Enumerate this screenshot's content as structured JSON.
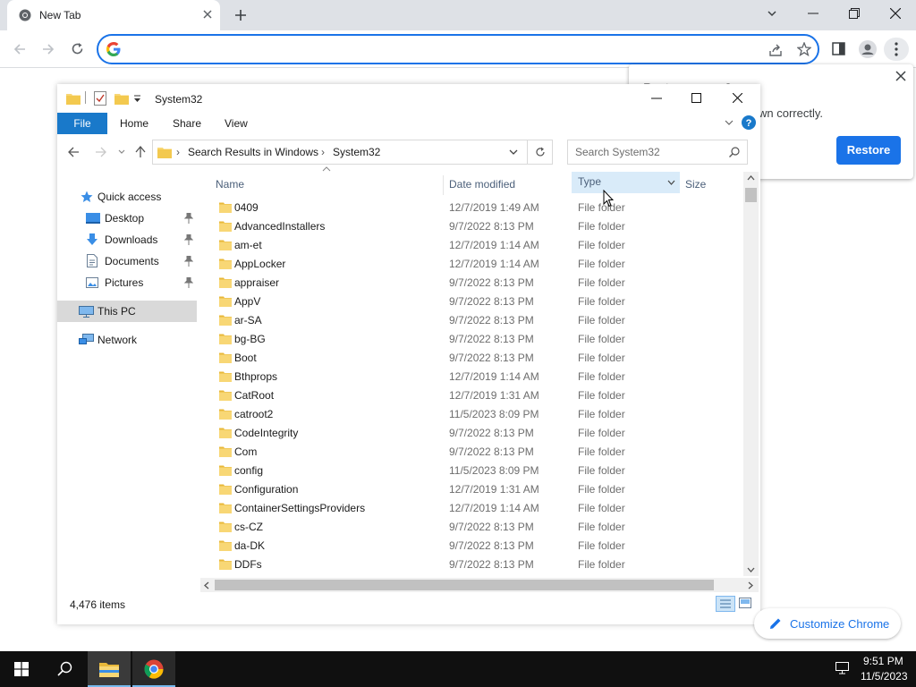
{
  "browser": {
    "tab_title": "New Tab",
    "new_tab_icon": "plus-icon",
    "customize_label": "Customize Chrome"
  },
  "restore_bubble": {
    "title_partial": "Restore pages?",
    "message_partial": "wn correctly.",
    "restore_label": "Restore"
  },
  "explorer": {
    "title": "System32",
    "ribbon_tabs": [
      "File",
      "Home",
      "Share",
      "View"
    ],
    "breadcrumb": [
      "Search Results in Windows",
      "System32"
    ],
    "search_placeholder": "Search System32",
    "nav": {
      "quick_access": "Quick access",
      "desktop": "Desktop",
      "downloads": "Downloads",
      "documents": "Documents",
      "pictures": "Pictures",
      "this_pc": "This PC",
      "network": "Network"
    },
    "columns": {
      "name": "Name",
      "date": "Date modified",
      "type": "Type",
      "size": "Size"
    },
    "rows": [
      {
        "name": "0409",
        "date": "12/7/2019 1:49 AM",
        "type": "File folder"
      },
      {
        "name": "AdvancedInstallers",
        "date": "9/7/2022 8:13 PM",
        "type": "File folder"
      },
      {
        "name": "am-et",
        "date": "12/7/2019 1:14 AM",
        "type": "File folder"
      },
      {
        "name": "AppLocker",
        "date": "12/7/2019 1:14 AM",
        "type": "File folder"
      },
      {
        "name": "appraiser",
        "date": "9/7/2022 8:13 PM",
        "type": "File folder"
      },
      {
        "name": "AppV",
        "date": "9/7/2022 8:13 PM",
        "type": "File folder"
      },
      {
        "name": "ar-SA",
        "date": "9/7/2022 8:13 PM",
        "type": "File folder"
      },
      {
        "name": "bg-BG",
        "date": "9/7/2022 8:13 PM",
        "type": "File folder"
      },
      {
        "name": "Boot",
        "date": "9/7/2022 8:13 PM",
        "type": "File folder"
      },
      {
        "name": "Bthprops",
        "date": "12/7/2019 1:14 AM",
        "type": "File folder"
      },
      {
        "name": "CatRoot",
        "date": "12/7/2019 1:31 AM",
        "type": "File folder"
      },
      {
        "name": "catroot2",
        "date": "11/5/2023 8:09 PM",
        "type": "File folder"
      },
      {
        "name": "CodeIntegrity",
        "date": "9/7/2022 8:13 PM",
        "type": "File folder"
      },
      {
        "name": "Com",
        "date": "9/7/2022 8:13 PM",
        "type": "File folder"
      },
      {
        "name": "config",
        "date": "11/5/2023 8:09 PM",
        "type": "File folder"
      },
      {
        "name": "Configuration",
        "date": "12/7/2019 1:31 AM",
        "type": "File folder"
      },
      {
        "name": "ContainerSettingsProviders",
        "date": "12/7/2019 1:14 AM",
        "type": "File folder"
      },
      {
        "name": "cs-CZ",
        "date": "9/7/2022 8:13 PM",
        "type": "File folder"
      },
      {
        "name": "da-DK",
        "date": "9/7/2022 8:13 PM",
        "type": "File folder"
      },
      {
        "name": "DDFs",
        "date": "9/7/2022 8:13 PM",
        "type": "File folder"
      }
    ],
    "status_items": "4,476 items"
  },
  "taskbar": {
    "time": "9:51 PM",
    "date": "11/5/2023"
  },
  "colors": {
    "accent": "#1a73e8",
    "file_tab": "#1979ca",
    "folder": "#f8d775",
    "taskbar": "#101010"
  }
}
